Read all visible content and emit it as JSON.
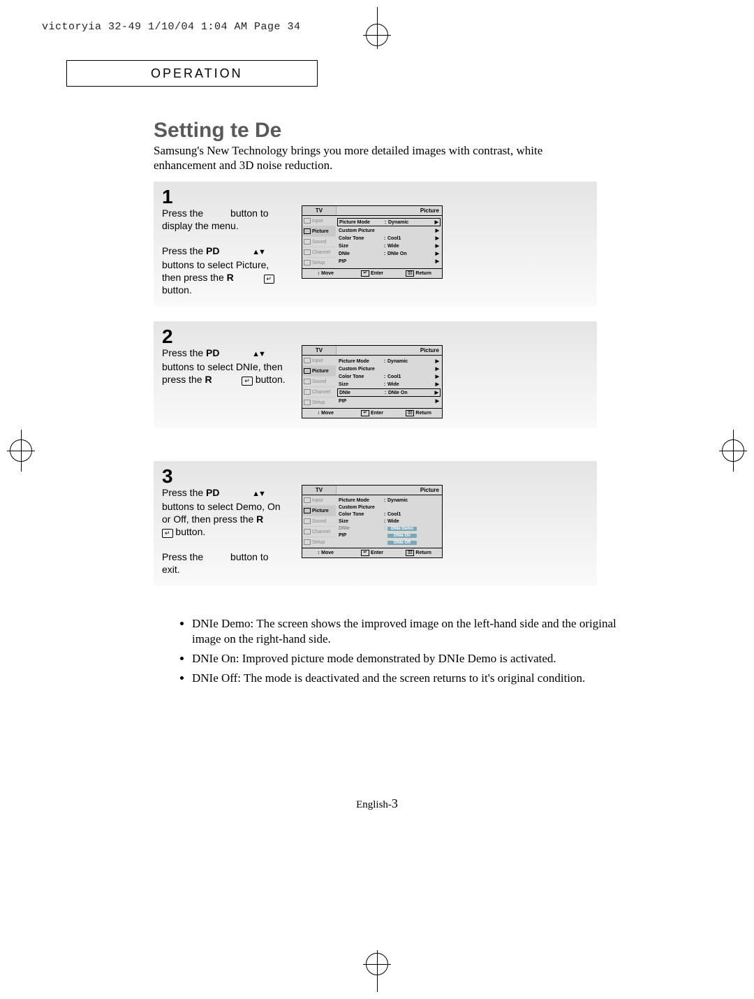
{
  "header": "victoryia 32-49  1/10/04 1:04 AM  Page 34",
  "section": "OPERATION",
  "title": "Setting te De",
  "intro": "Samsung's New Technology brings you more detailed images with contrast, white enhancement and 3D noise reduction.",
  "steps": [
    {
      "num": "1",
      "text": "Press the        button to display the menu.\n\nPress the PD            ▲▼ buttons to select Picture, then press the R           ↵ button."
    },
    {
      "num": "2",
      "text": "Press the PD            ▲▼ buttons to select DNIe, then press the R           ↵ button."
    },
    {
      "num": "3",
      "text": "Press the PD            ▲▼ buttons to select Demo, On or Off, then press the R          ↵ button.\n\nPress the        button to exit."
    }
  ],
  "tv": {
    "header_left": "TV",
    "header_right": "Picture",
    "tabs": [
      {
        "name": "Input"
      },
      {
        "name": "Picture"
      },
      {
        "name": "Sound"
      },
      {
        "name": "Channel"
      },
      {
        "name": "Setup"
      }
    ],
    "menu1": [
      {
        "label": "Picture Mode",
        "value": "Dynamic",
        "boxed": true
      },
      {
        "label": "Custom Picture",
        "value": ""
      },
      {
        "label": "Color Tone",
        "value": "Cool1"
      },
      {
        "label": "Size",
        "value": "Wide"
      },
      {
        "label": "DNIe",
        "value": "DNIe On"
      },
      {
        "label": "PIP",
        "value": ""
      }
    ],
    "menu2_boxed_index": 4,
    "menu3_sub": [
      "DNIe Demo",
      "DNIe On",
      "DNIe Off"
    ],
    "foot": {
      "move": "Move",
      "enter": "Enter",
      "return": "Return",
      "updown": "↕",
      "arr": "↵",
      "ret": "▮▯▯"
    }
  },
  "bullets": [
    "DNIe Demo: The screen shows the improved image on the left-hand side and the original image on the right-hand side.",
    "DNIe On: Improved picture mode demonstrated by DNIe Demo is activated.",
    "DNIe Off: The mode is deactivated and the screen returns to it's original condition."
  ],
  "pagenum_prefix": "English-",
  "pagenum": "3"
}
